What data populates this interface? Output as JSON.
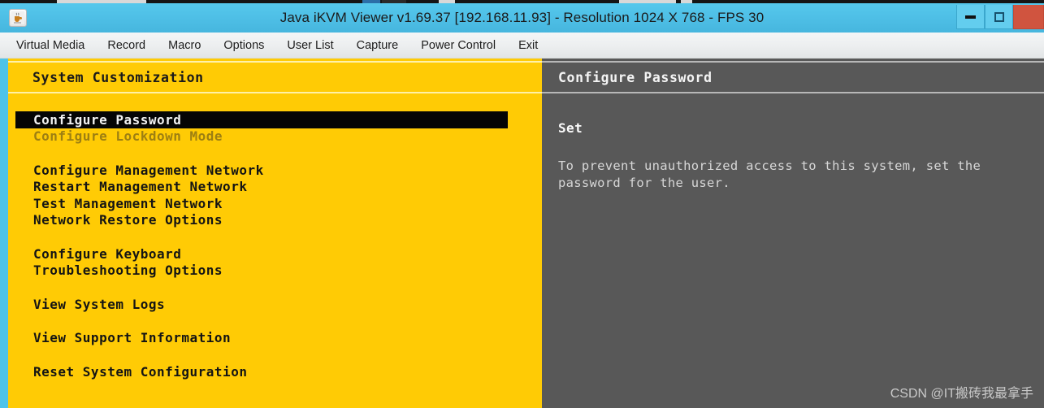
{
  "window": {
    "title": "Java iKVM Viewer v1.69.37 [192.168.11.93]  -  Resolution 1024 X 768 - FPS 30",
    "app_icon": "java-coffee-cup-icon",
    "controls": {
      "minimize": "minimize-icon",
      "maximize": "maximize-icon",
      "close": "close-icon"
    }
  },
  "menubar": {
    "items": [
      {
        "label": "Virtual Media"
      },
      {
        "label": "Record"
      },
      {
        "label": "Macro"
      },
      {
        "label": "Options"
      },
      {
        "label": "User List"
      },
      {
        "label": "Capture"
      },
      {
        "label": "Power Control"
      },
      {
        "label": "Exit"
      }
    ]
  },
  "console": {
    "left_pane": {
      "header": "System Customization",
      "items": [
        {
          "label": "Configure Password",
          "state": "selected"
        },
        {
          "label": "Configure Lockdown Mode",
          "state": "disabled"
        },
        {
          "label": "",
          "state": "spacer"
        },
        {
          "label": "Configure Management Network",
          "state": "normal"
        },
        {
          "label": "Restart Management Network",
          "state": "normal"
        },
        {
          "label": "Test Management Network",
          "state": "normal"
        },
        {
          "label": "Network Restore Options",
          "state": "normal"
        },
        {
          "label": "",
          "state": "spacer"
        },
        {
          "label": "Configure Keyboard",
          "state": "normal"
        },
        {
          "label": "Troubleshooting Options",
          "state": "normal"
        },
        {
          "label": "",
          "state": "spacer"
        },
        {
          "label": "View System Logs",
          "state": "normal"
        },
        {
          "label": "",
          "state": "spacer"
        },
        {
          "label": "View Support Information",
          "state": "normal"
        },
        {
          "label": "",
          "state": "spacer"
        },
        {
          "label": "Reset System Configuration",
          "state": "normal"
        }
      ]
    },
    "right_pane": {
      "header": "Configure Password",
      "subtitle": "Set",
      "description": "To prevent unauthorized access to this system, set the password for the user."
    }
  },
  "watermark": "CSDN @IT搬砖我最拿手",
  "colors": {
    "titlebar": "#4fc3e8",
    "yellow_pane": "#ffcb05",
    "dark_pane": "#585858",
    "selection": "#050505",
    "close_button": "#d0543f",
    "disabled_text": "#9d7f12"
  }
}
